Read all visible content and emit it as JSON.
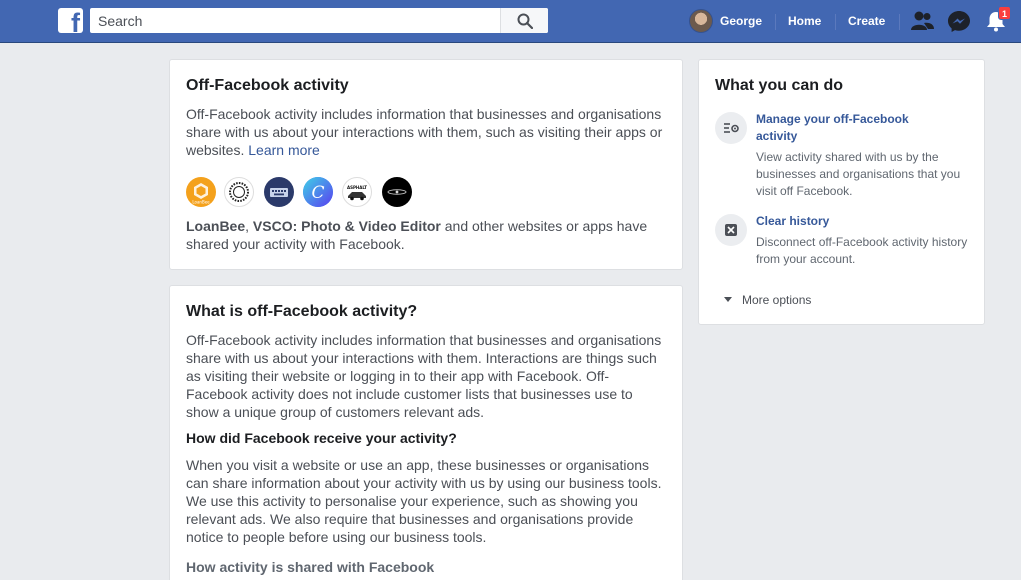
{
  "header": {
    "logo_letter": "f",
    "search_placeholder": "Search",
    "user_name": "George",
    "nav_home": "Home",
    "nav_create": "Create",
    "notification_count": "1",
    "brand_color": "#4267b2"
  },
  "card1": {
    "title": "Off-Facebook activity",
    "description": "Off-Facebook activity includes information that businesses and organisations share with us about your interactions with them, such as visiting their apps or websites.",
    "learn_more": "Learn more",
    "app_name_1": "LoanBee",
    "separator": ", ",
    "app_name_2": "VSCO: Photo & Video Editor",
    "summary_tail": " and other websites or apps have shared your activity with Facebook.",
    "app_icons": [
      "loanbee-icon",
      "vsco-icon",
      "keyboard-app-icon",
      "canva-icon",
      "asphalt-icon",
      "dark-app-icon"
    ],
    "app_icon_text": {
      "loanbee": "LoanBee",
      "canva": "C",
      "asphalt": "ASPHALT"
    }
  },
  "card2": {
    "title": "What is off-Facebook activity?",
    "paragraph1": "Off-Facebook activity includes information that businesses and organisations share with us about your interactions with them. Interactions are things such as visiting their website or logging in to their app with Facebook. Off-Facebook activity does not include customer lists that businesses use to show a unique group of customers relevant ads.",
    "heading2": "How did Facebook receive your activity?",
    "paragraph2": "When you visit a website or use an app, these businesses or organisations can share information about your activity with us by using our business tools. We use this activity to personalise your experience, such as showing you relevant ads. We also require that businesses and organisations provide notice to people before using our business tools.",
    "heading3": "How activity is shared with Facebook"
  },
  "sidebar": {
    "title": "What you can do",
    "items": [
      {
        "icon": "manage-list-icon",
        "link": "Manage your off-Facebook activity",
        "description": "View activity shared with us by the businesses and organisations that you visit off Facebook."
      },
      {
        "icon": "clear-x-icon",
        "link": "Clear history",
        "description": "Disconnect off-Facebook activity history from your account."
      }
    ],
    "more_options": "More options"
  }
}
